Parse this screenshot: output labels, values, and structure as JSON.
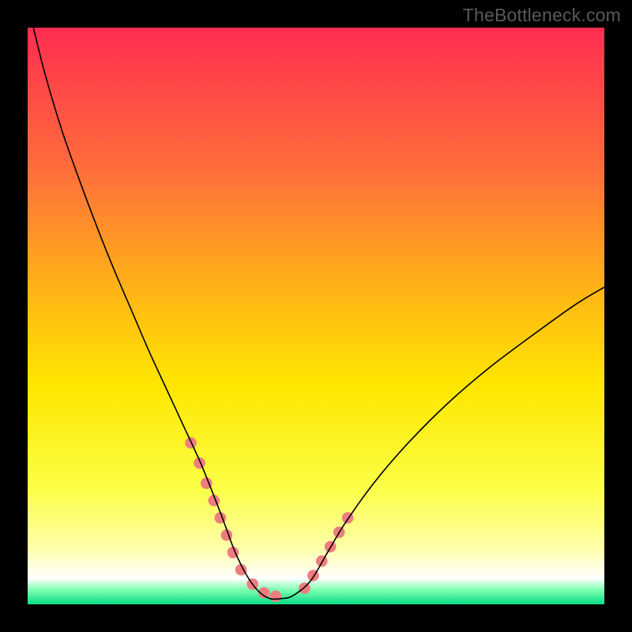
{
  "watermark": "TheBottleneck.com",
  "chart_data": {
    "type": "line",
    "title": "",
    "xlabel": "",
    "ylabel": "",
    "xlim": [
      0,
      100
    ],
    "ylim": [
      0,
      100
    ],
    "grid": false,
    "legend": false,
    "background_gradient_stops": [
      {
        "offset": 0.0,
        "color": "#ff2d51"
      },
      {
        "offset": 0.25,
        "color": "#ff6f3a"
      },
      {
        "offset": 0.47,
        "color": "#ffb914"
      },
      {
        "offset": 0.62,
        "color": "#ffe600"
      },
      {
        "offset": 0.8,
        "color": "#fbff47"
      },
      {
        "offset": 0.9,
        "color": "#ffffa7"
      },
      {
        "offset": 0.955,
        "color": "#ffffff"
      },
      {
        "offset": 0.975,
        "color": "#7dffb0"
      },
      {
        "offset": 1.0,
        "color": "#08db85"
      }
    ],
    "series": [
      {
        "name": "bottleneck-curve",
        "stroke": "#000000",
        "stroke_width": 1.6,
        "x": [
          1.0,
          3,
          6,
          9,
          12,
          15,
          18,
          21,
          24,
          27,
          30,
          33,
          34.5,
          36,
          38,
          40,
          42,
          44,
          46,
          49,
          52,
          55,
          60,
          66,
          73,
          80,
          88,
          95,
          100
        ],
        "y": [
          100,
          92,
          82,
          73.5,
          65.5,
          58,
          51,
          44,
          37.5,
          31,
          24.5,
          17,
          13,
          9,
          5,
          2.3,
          1.0,
          1.0,
          1.5,
          4,
          9,
          14,
          21,
          28,
          35,
          41,
          47,
          52,
          55
        ]
      }
    ],
    "markers": {
      "color": "#ee7d7f",
      "radius": 7.3,
      "groups": [
        {
          "name": "left-cluster",
          "x": [
            28.3,
            29.8,
            31.0,
            32.3,
            33.4,
            34.5,
            35.6,
            37.0,
            39.0,
            41.0,
            43.0
          ],
          "y": [
            28.0,
            24.5,
            21.0,
            18.0,
            15.0,
            12.0,
            9.0,
            6.0,
            3.5,
            2.0,
            1.4
          ]
        },
        {
          "name": "right-cluster",
          "x": [
            48.0,
            49.5,
            51.0,
            52.5,
            54.0,
            55.5
          ],
          "y": [
            2.8,
            5.0,
            7.5,
            10.0,
            12.5,
            15.0
          ]
        }
      ]
    }
  }
}
